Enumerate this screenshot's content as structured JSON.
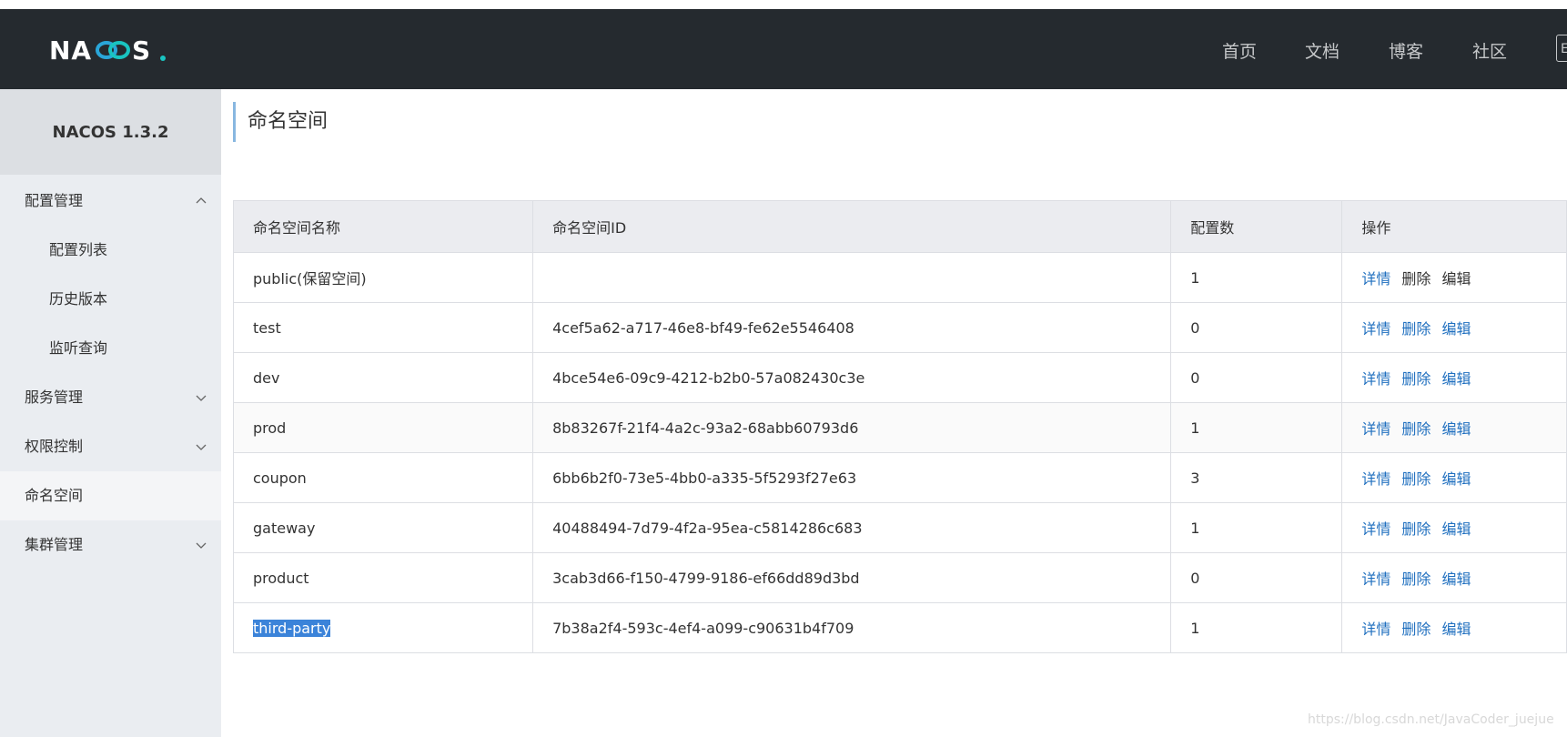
{
  "header": {
    "logo": "NACOS.",
    "nav": [
      "首页",
      "文档",
      "博客",
      "社区"
    ],
    "lang_partial": "E"
  },
  "sidebar": {
    "title": "NACOS 1.3.2",
    "items": [
      {
        "label": "配置管理",
        "chevron": "up"
      },
      {
        "label": "配置列表"
      },
      {
        "label": "历史版本"
      },
      {
        "label": "监听查询"
      },
      {
        "label": "服务管理",
        "chevron": "down"
      },
      {
        "label": "权限控制",
        "chevron": "down"
      },
      {
        "label": "命名空间"
      },
      {
        "label": "集群管理",
        "chevron": "down"
      }
    ]
  },
  "main": {
    "title": "命名空间",
    "columns": [
      "命名空间名称",
      "命名空间ID",
      "配置数",
      "操作"
    ],
    "rows": [
      {
        "name": "public(保留空间)",
        "id": "",
        "count": "1",
        "actions": [
          "详情",
          "删除",
          "编辑"
        ]
      },
      {
        "name": "test",
        "id": "4cef5a62-a717-46e8-bf49-fe62e5546408",
        "count": "0",
        "actions": [
          "详情",
          "删除",
          "编辑"
        ]
      },
      {
        "name": "dev",
        "id": "4bce54e6-09c9-4212-b2b0-57a082430c3e",
        "count": "0",
        "actions": [
          "详情",
          "删除",
          "编辑"
        ]
      },
      {
        "name": "prod",
        "id": "8b83267f-21f4-4a2c-93a2-68abb60793d6",
        "count": "1",
        "actions": [
          "详情",
          "删除",
          "编辑"
        ]
      },
      {
        "name": "coupon",
        "id": "6bb6b2f0-73e5-4bb0-a335-5f5293f27e63",
        "count": "3",
        "actions": [
          "详情",
          "删除",
          "编辑"
        ]
      },
      {
        "name": "gateway",
        "id": "40488494-7d79-4f2a-95ea-c5814286c683",
        "count": "1",
        "actions": [
          "详情",
          "删除",
          "编辑"
        ]
      },
      {
        "name": "product",
        "id": "3cab3d66-f150-4799-9186-ef66dd89d3bd",
        "count": "0",
        "actions": [
          "详情",
          "删除",
          "编辑"
        ]
      },
      {
        "name": "third-party",
        "id": "7b38a2f4-593c-4ef4-a099-c90631b4f709",
        "count": "1",
        "actions": [
          "详情",
          "删除",
          "编辑"
        ]
      }
    ]
  },
  "watermark": "https://blog.csdn.net/JavaCoder_juejue",
  "colors": {
    "header_bg": "#252a2f",
    "link": "#1f6fbf",
    "sidebar_bg": "#eaedf1",
    "selection": "#3b83d9"
  }
}
